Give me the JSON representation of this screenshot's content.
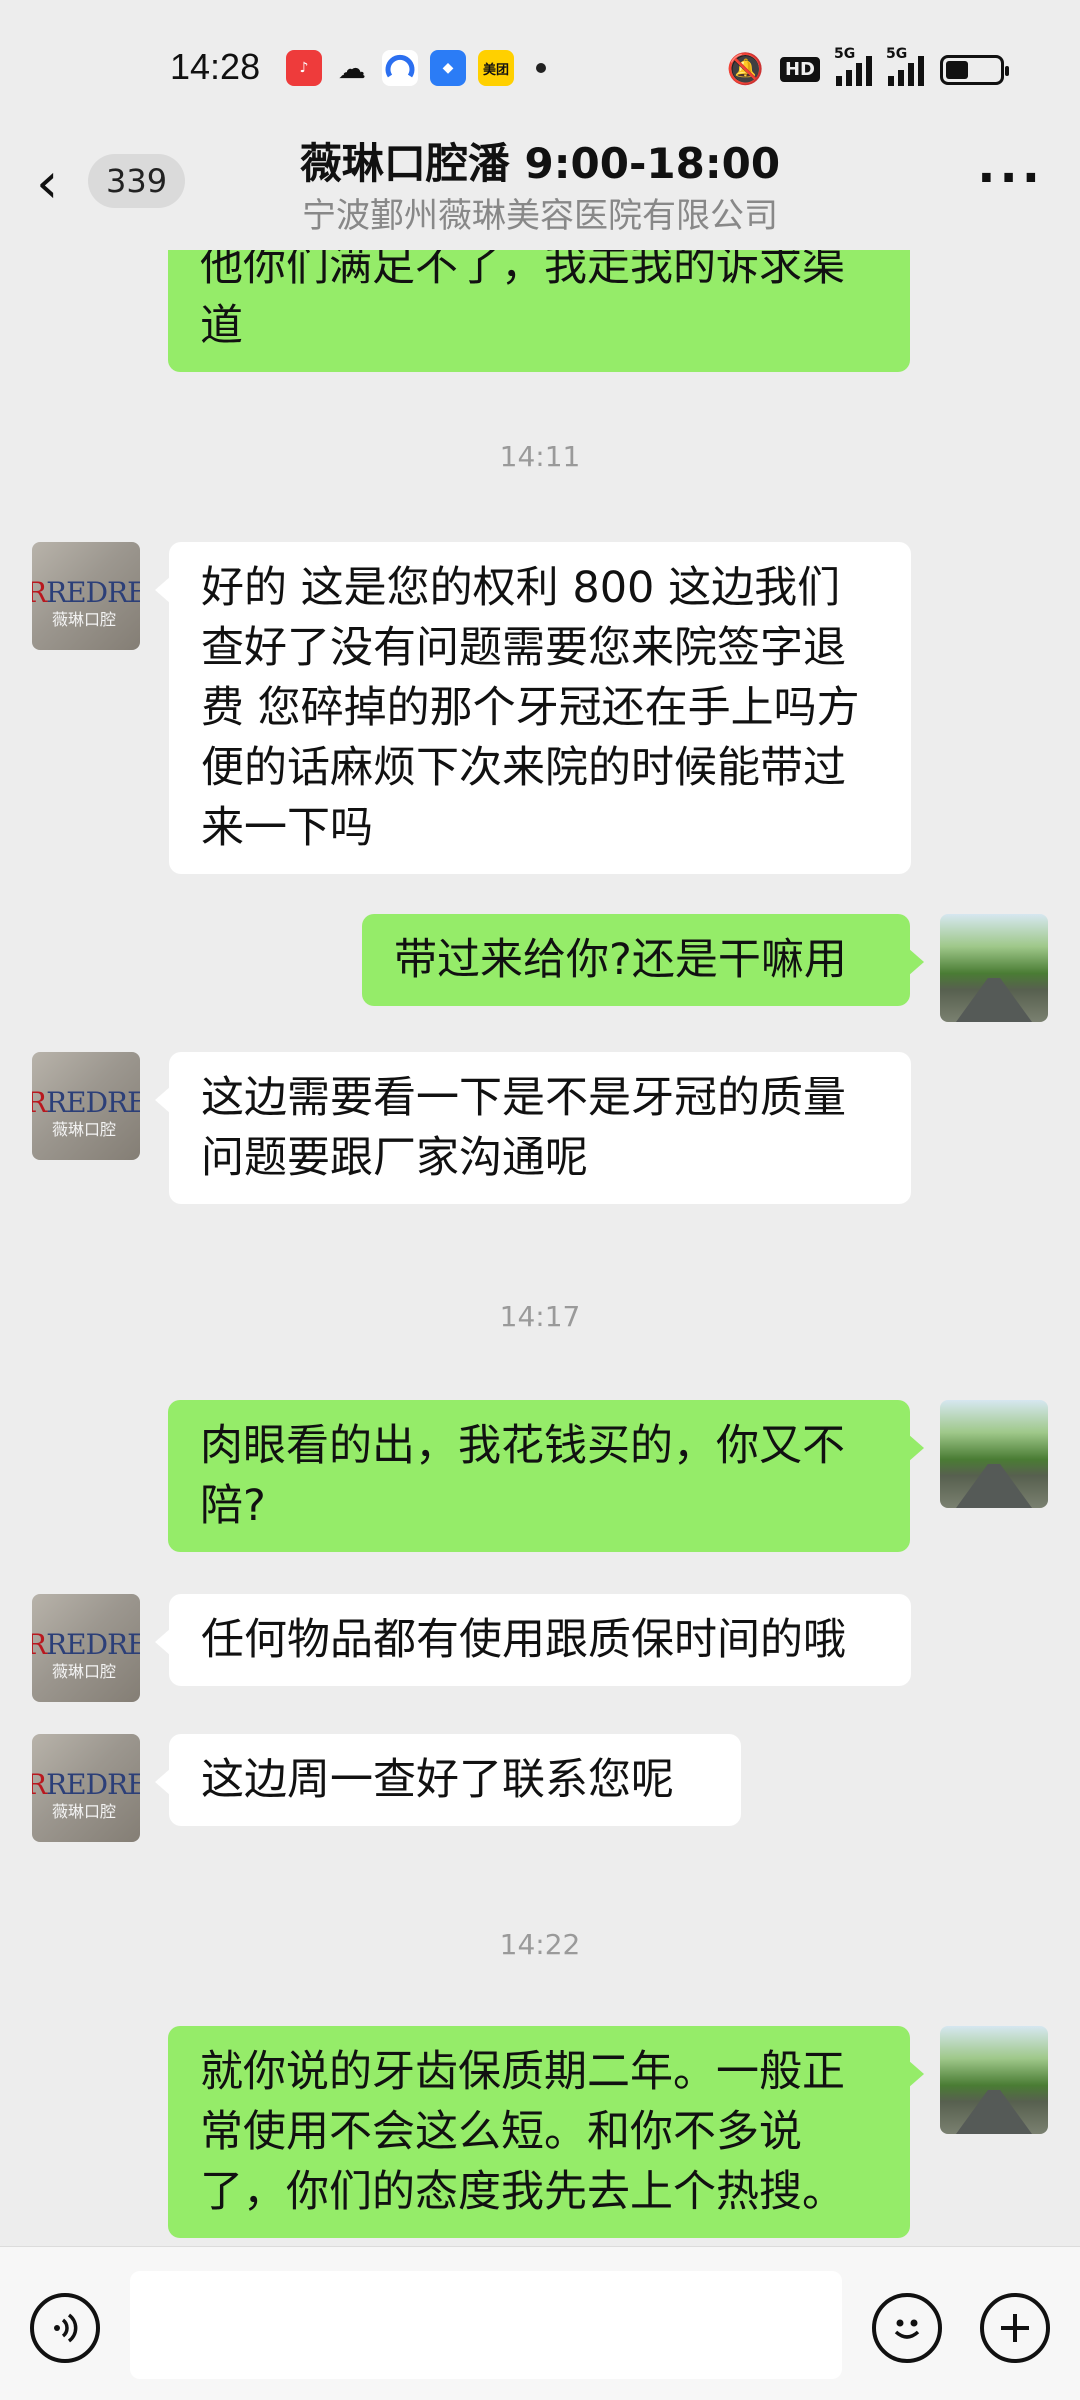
{
  "status_bar": {
    "time": "14:28",
    "app_icons": [
      "music-app-icon",
      "wechat-icon",
      "app-icon-circle",
      "app-icon-blue",
      "meituan-icon"
    ],
    "meituan_label": "美团",
    "hd_label": "HD",
    "signal1_label": "5G",
    "signal2_label": "5G"
  },
  "header": {
    "back_icon": "chevron-left-icon",
    "unread_count": "339",
    "title": "薇琳口腔潘 9:00-18:00",
    "subtitle": "宁波鄞州薇琳美容医院有限公司",
    "more_icon": "more-icon",
    "more_label": "···"
  },
  "chat": {
    "clipped_top_message": "他你们满足不了，我走我的诉求渠道",
    "clinic_avatar_logo": "REDREAM",
    "clinic_avatar_sub": "薇琳口腔",
    "messages": [
      {
        "type": "time",
        "text": "14:11"
      },
      {
        "type": "in",
        "text": "好的 这是您的权利 800 这边我们查好了没有问题需要您来院签字退费 您碎掉的那个牙冠还在手上吗方便的话麻烦下次来院的时候能带过来一下吗"
      },
      {
        "type": "out",
        "text": "带过来给你?还是干嘛用"
      },
      {
        "type": "in",
        "text": "这边需要看一下是不是牙冠的质量问题要跟厂家沟通呢"
      },
      {
        "type": "time",
        "text": "14:17"
      },
      {
        "type": "out",
        "text": "肉眼看的出，我花钱买的，你又不陪?"
      },
      {
        "type": "in",
        "text": "任何物品都有使用跟质保时间的哦"
      },
      {
        "type": "in",
        "text": "这边周一查好了联系您呢"
      },
      {
        "type": "time",
        "text": "14:22"
      },
      {
        "type": "out",
        "text": "就你说的牙齿保质期二年。一般正常使用不会这么短。和你不多说了，你们的态度我先去上个热搜。"
      }
    ]
  },
  "input_bar": {
    "voice_icon": "voice-icon",
    "emoji_icon": "emoji-icon",
    "plus_icon": "plus-icon",
    "input_value": ""
  }
}
